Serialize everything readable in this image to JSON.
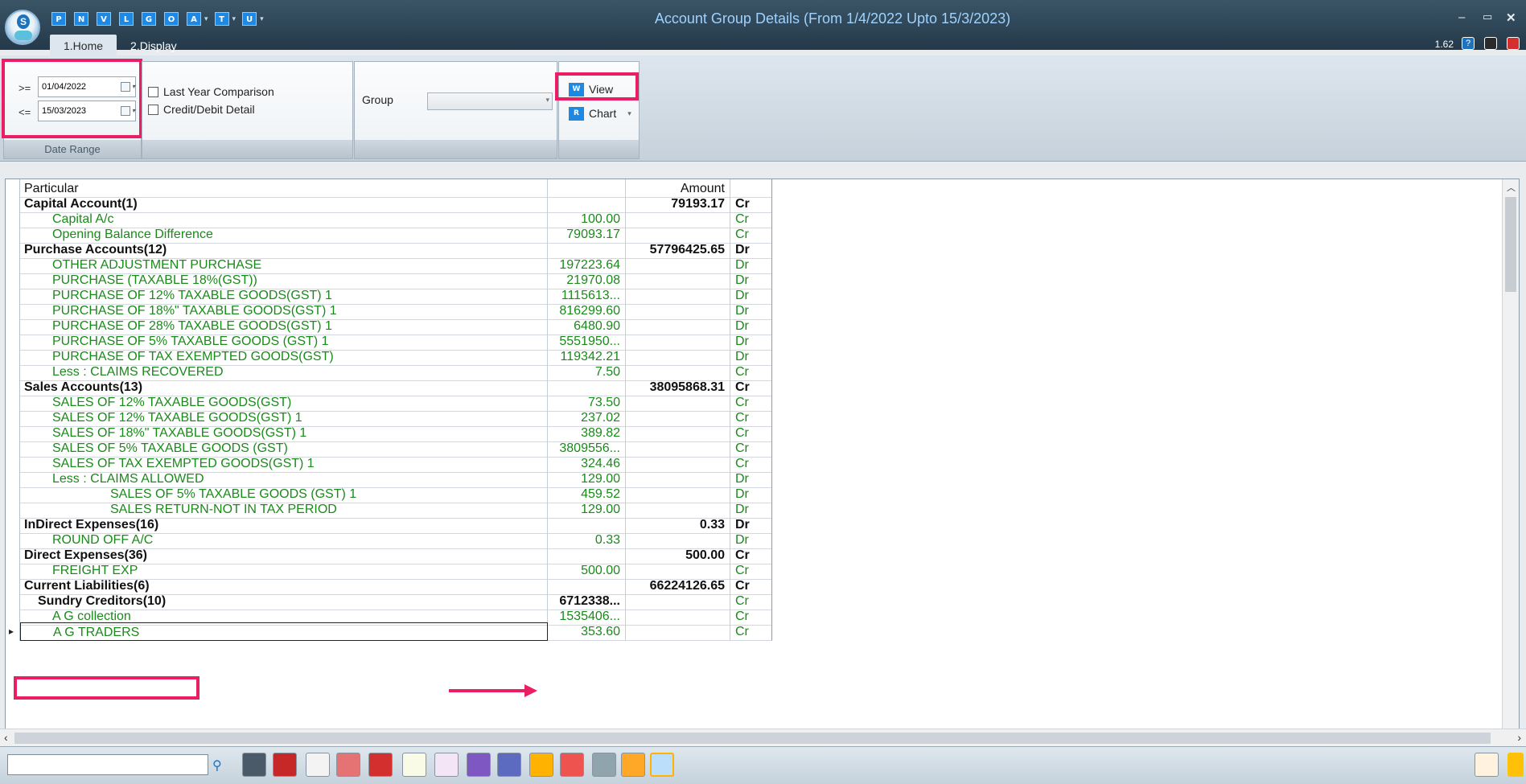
{
  "window": {
    "title": "Account Group Details (From 1/4/2022 Upto 15/3/2023)",
    "version": "1.62"
  },
  "quick_access": [
    "P",
    "N",
    "V",
    "L",
    "G",
    "O",
    "A",
    "T",
    "U"
  ],
  "tabs": [
    {
      "label": "1.Home"
    },
    {
      "label": "2.Display"
    }
  ],
  "ribbon": {
    "date_range": {
      "from_op": ">=",
      "from_value": "01/04/2022",
      "to_op": "<=",
      "to_value": "15/03/2023",
      "footer": "Date Range"
    },
    "options": {
      "last_year_comparison": "Last Year Comparison",
      "credit_debit_detail": "Credit/Debit Detail"
    },
    "group": {
      "label": "Group",
      "value": ""
    },
    "actions": {
      "view": "View",
      "chart": "Chart"
    }
  },
  "grid": {
    "headers": {
      "particular": "Particular",
      "value": "",
      "amount": "Amount",
      "drcr": ""
    },
    "rows": [
      {
        "particular": "Capital Account(1)",
        "value": "",
        "amount": "79193.17",
        "drcr": "Cr",
        "level": 0
      },
      {
        "particular": "Capital A/c",
        "value": "100.00",
        "amount": "",
        "drcr": "Cr",
        "level": 1
      },
      {
        "particular": "Opening Balance Difference",
        "value": "79093.17",
        "amount": "",
        "drcr": "Cr",
        "level": 1
      },
      {
        "particular": "Purchase Accounts(12)",
        "value": "",
        "amount": "57796425.65",
        "drcr": "Dr",
        "level": 0
      },
      {
        "particular": "OTHER ADJUSTMENT PURCHASE",
        "value": "197223.64",
        "amount": "",
        "drcr": "Dr",
        "level": 1
      },
      {
        "particular": "PURCHASE (TAXABLE 18%(GST))",
        "value": "21970.08",
        "amount": "",
        "drcr": "Dr",
        "level": 1
      },
      {
        "particular": "PURCHASE OF 12% TAXABLE GOODS(GST) 1",
        "value": "1115613...",
        "amount": "",
        "drcr": "Dr",
        "level": 1
      },
      {
        "particular": "PURCHASE OF 18%\" TAXABLE GOODS(GST) 1",
        "value": "816299.60",
        "amount": "",
        "drcr": "Dr",
        "level": 1
      },
      {
        "particular": "PURCHASE OF 28% TAXABLE GOODS(GST) 1",
        "value": "6480.90",
        "amount": "",
        "drcr": "Dr",
        "level": 1
      },
      {
        "particular": "PURCHASE OF 5% TAXABLE GOODS (GST) 1",
        "value": "5551950...",
        "amount": "",
        "drcr": "Dr",
        "level": 1
      },
      {
        "particular": "PURCHASE OF TAX EXEMPTED GOODS(GST)",
        "value": "119342.21",
        "amount": "",
        "drcr": "Dr",
        "level": 1
      },
      {
        "particular": "Less : CLAIMS RECOVERED",
        "value": "7.50",
        "amount": "",
        "drcr": "Cr",
        "level": 1
      },
      {
        "particular": "Sales Accounts(13)",
        "value": "",
        "amount": "38095868.31",
        "drcr": "Cr",
        "level": 0
      },
      {
        "particular": "SALES OF 12% TAXABLE GOODS(GST)",
        "value": "73.50",
        "amount": "",
        "drcr": "Cr",
        "level": 1
      },
      {
        "particular": "SALES OF 12% TAXABLE GOODS(GST) 1",
        "value": "237.02",
        "amount": "",
        "drcr": "Cr",
        "level": 1
      },
      {
        "particular": "SALES OF 18%\" TAXABLE GOODS(GST) 1",
        "value": "389.82",
        "amount": "",
        "drcr": "Cr",
        "level": 1
      },
      {
        "particular": "SALES OF 5% TAXABLE GOODS (GST)",
        "value": "3809556...",
        "amount": "",
        "drcr": "Cr",
        "level": 1
      },
      {
        "particular": "SALES OF TAX EXEMPTED GOODS(GST) 1",
        "value": "324.46",
        "amount": "",
        "drcr": "Cr",
        "level": 1
      },
      {
        "particular": "Less : CLAIMS ALLOWED",
        "value": "129.00",
        "amount": "",
        "drcr": "Dr",
        "level": 1
      },
      {
        "particular": "SALES OF 5% TAXABLE GOODS (GST) 1",
        "value": "459.52",
        "amount": "",
        "drcr": "Dr",
        "level": 2
      },
      {
        "particular": "SALES RETURN-NOT IN TAX PERIOD",
        "value": "129.00",
        "amount": "",
        "drcr": "Dr",
        "level": 2
      },
      {
        "particular": "InDirect Expenses(16)",
        "value": "",
        "amount": "0.33",
        "drcr": "Dr",
        "level": 0
      },
      {
        "particular": "ROUND OFF A/C",
        "value": "0.33",
        "amount": "",
        "drcr": "Dr",
        "level": 1
      },
      {
        "particular": "Direct Expenses(36)",
        "value": "",
        "amount": "500.00",
        "drcr": "Cr",
        "level": 0
      },
      {
        "particular": "FREIGHT EXP",
        "value": "500.00",
        "amount": "",
        "drcr": "Cr",
        "level": 1
      },
      {
        "particular": "Current Liabilities(6)",
        "value": "",
        "amount": "66224126.65",
        "drcr": "Cr",
        "level": 0
      },
      {
        "particular": "Sundry Creditors(10)",
        "value": "6712338...",
        "amount": "",
        "drcr": "Cr",
        "level": "sub"
      },
      {
        "particular": "A G collection",
        "value": "1535406...",
        "amount": "",
        "drcr": "Cr",
        "level": 1
      },
      {
        "particular": "A G TRADERS",
        "value": "353.60",
        "amount": "",
        "drcr": "Cr",
        "level": 1
      }
    ]
  },
  "colors": {
    "highlight": "#e91e63",
    "green_text": "#1a8a1a",
    "title_text": "#9fd2ff"
  }
}
